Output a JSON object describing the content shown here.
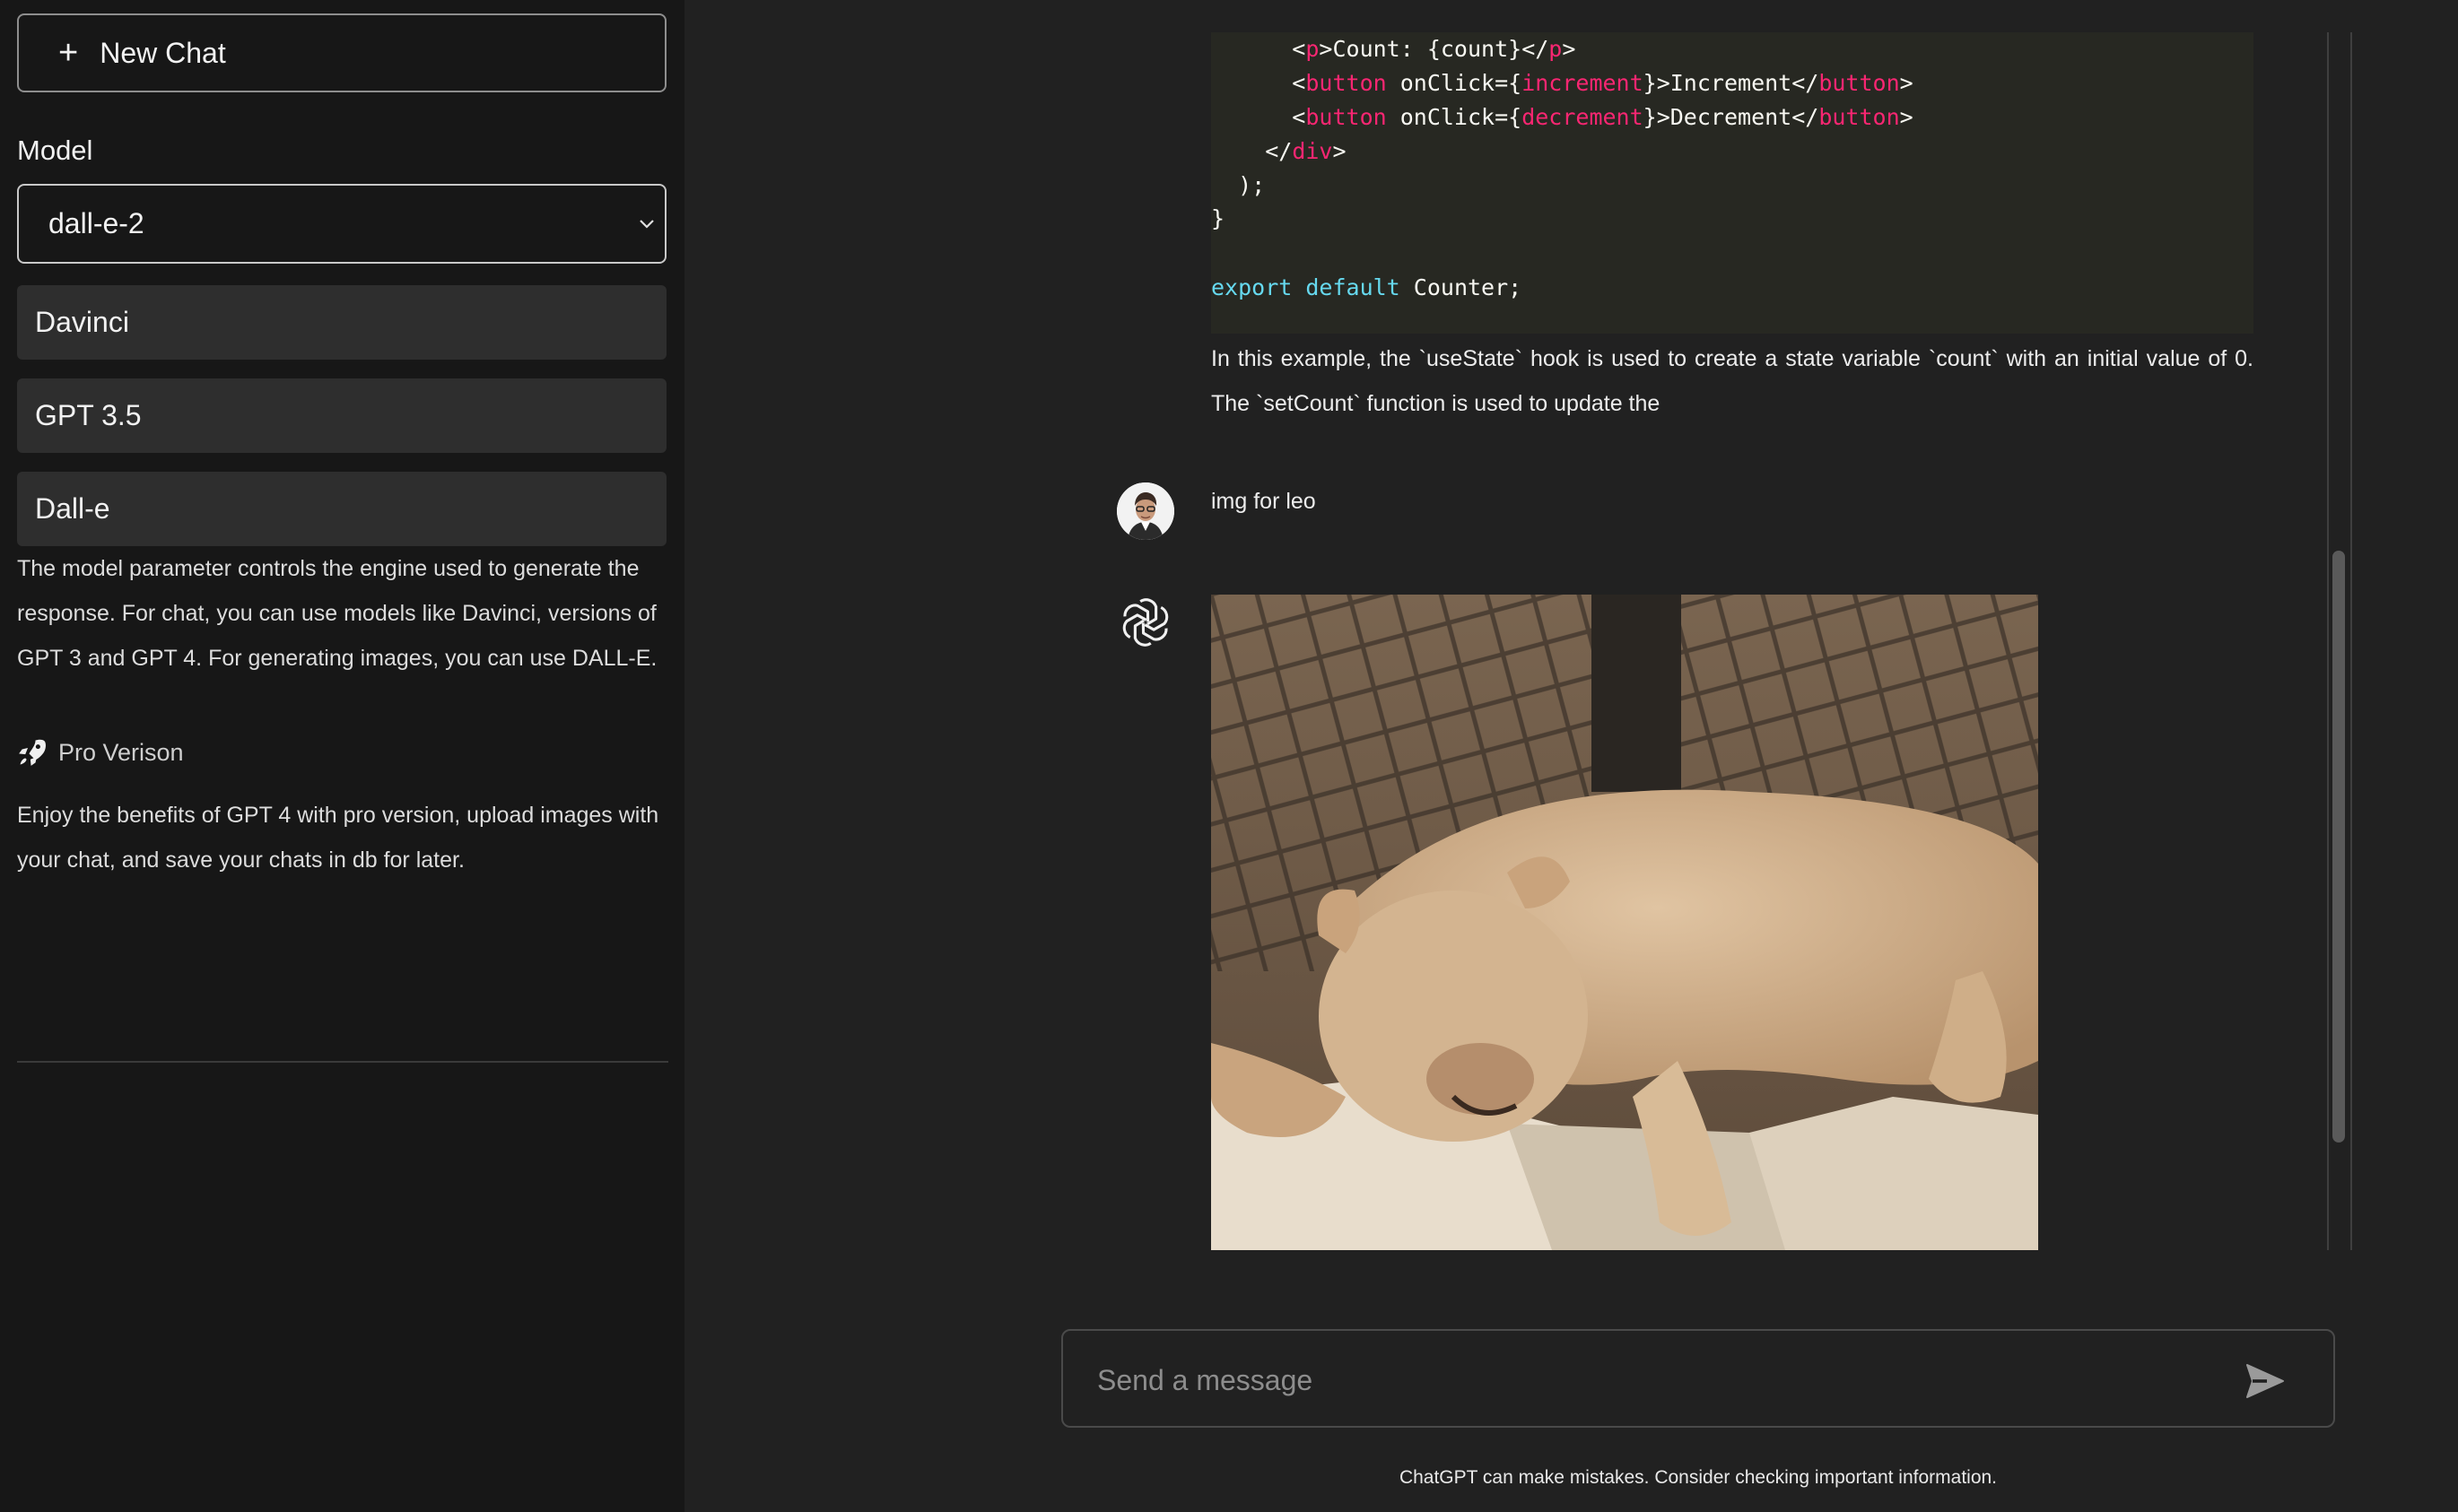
{
  "sidebar": {
    "new_chat_label": "New Chat",
    "model_heading": "Model",
    "selected_model": "dall-e-2",
    "model_options": [
      "Davinci",
      "GPT 3.5",
      "Dall-e"
    ],
    "model_description": "The model parameter controls the engine used to generate the response. For chat, you can use models like Davinci, versions of GPT 3 and GPT 4. For generating images, you can use DALL-E.",
    "pro_title": "Pro Verison",
    "pro_description": "Enjoy the benefits of GPT 4 with pro version, upload images with your chat, and save your chats in db for later."
  },
  "conversation": {
    "code_lines": [
      "      <p>Count: {count}</p>",
      "      <button onClick={increment}>Increment</button>",
      "      <button onClick={decrement}>Decrement</button>",
      "    </div>",
      "  );",
      "}",
      "",
      "export default Counter;"
    ],
    "answer_text": "In this example, the `useState` hook is used to create a state variable `count` with an initial value of 0. The `setCount` function is used to update the",
    "user_message": "img for leo"
  },
  "composer": {
    "placeholder": "Send a message",
    "disclaimer": "ChatGPT can make mistakes. Consider checking important information."
  },
  "icons": {
    "new_chat": "plus-icon",
    "select": "chevron-down-icon",
    "pro": "rocket-icon",
    "assistant": "openai-logo-icon",
    "send": "send-icon"
  },
  "colors": {
    "sidebar_bg": "#171717",
    "main_bg": "#212121",
    "code_bg": "#272822",
    "code_tag": "#f92672",
    "code_keyword": "#66d9ef"
  }
}
